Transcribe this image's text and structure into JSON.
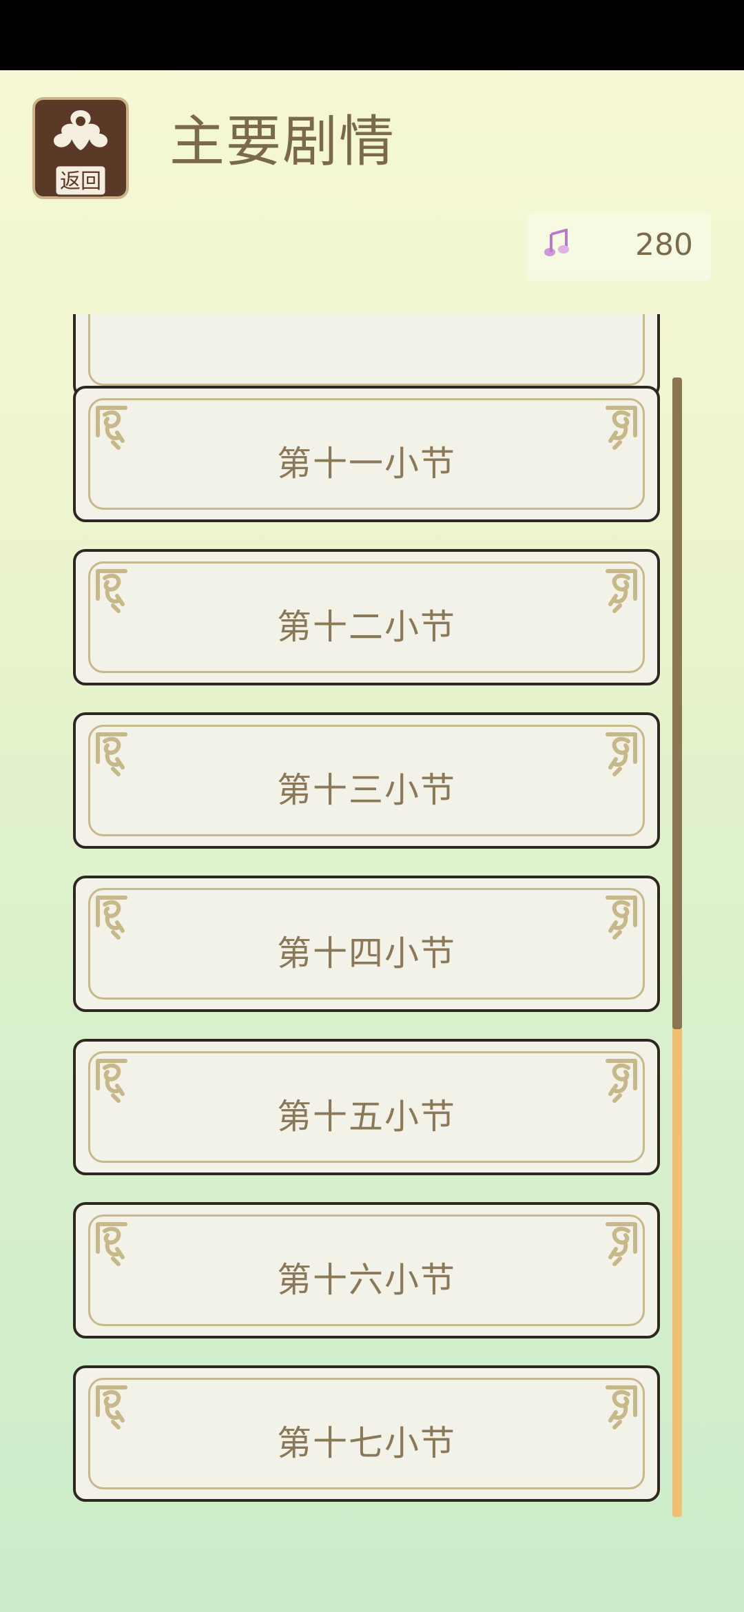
{
  "header": {
    "back_label": "返回",
    "title": "主要剧情"
  },
  "currency": {
    "icon": "music-note-icon",
    "count": "280"
  },
  "sections": [
    {
      "label": ""
    },
    {
      "label": "第十一小节"
    },
    {
      "label": "第十二小节"
    },
    {
      "label": "第十三小节"
    },
    {
      "label": "第十四小节"
    },
    {
      "label": "第十五小节"
    },
    {
      "label": "第十六小节"
    },
    {
      "label": "第十七小节"
    }
  ],
  "scroll": {
    "position_fraction": 0.57
  },
  "colors": {
    "card_bg": "#f3f2e8",
    "card_border": "#2e2620",
    "accent": "#c7b88a",
    "text": "#8a7858",
    "scroll_thumb": "#8a7650",
    "scroll_track": "#f0c070"
  }
}
